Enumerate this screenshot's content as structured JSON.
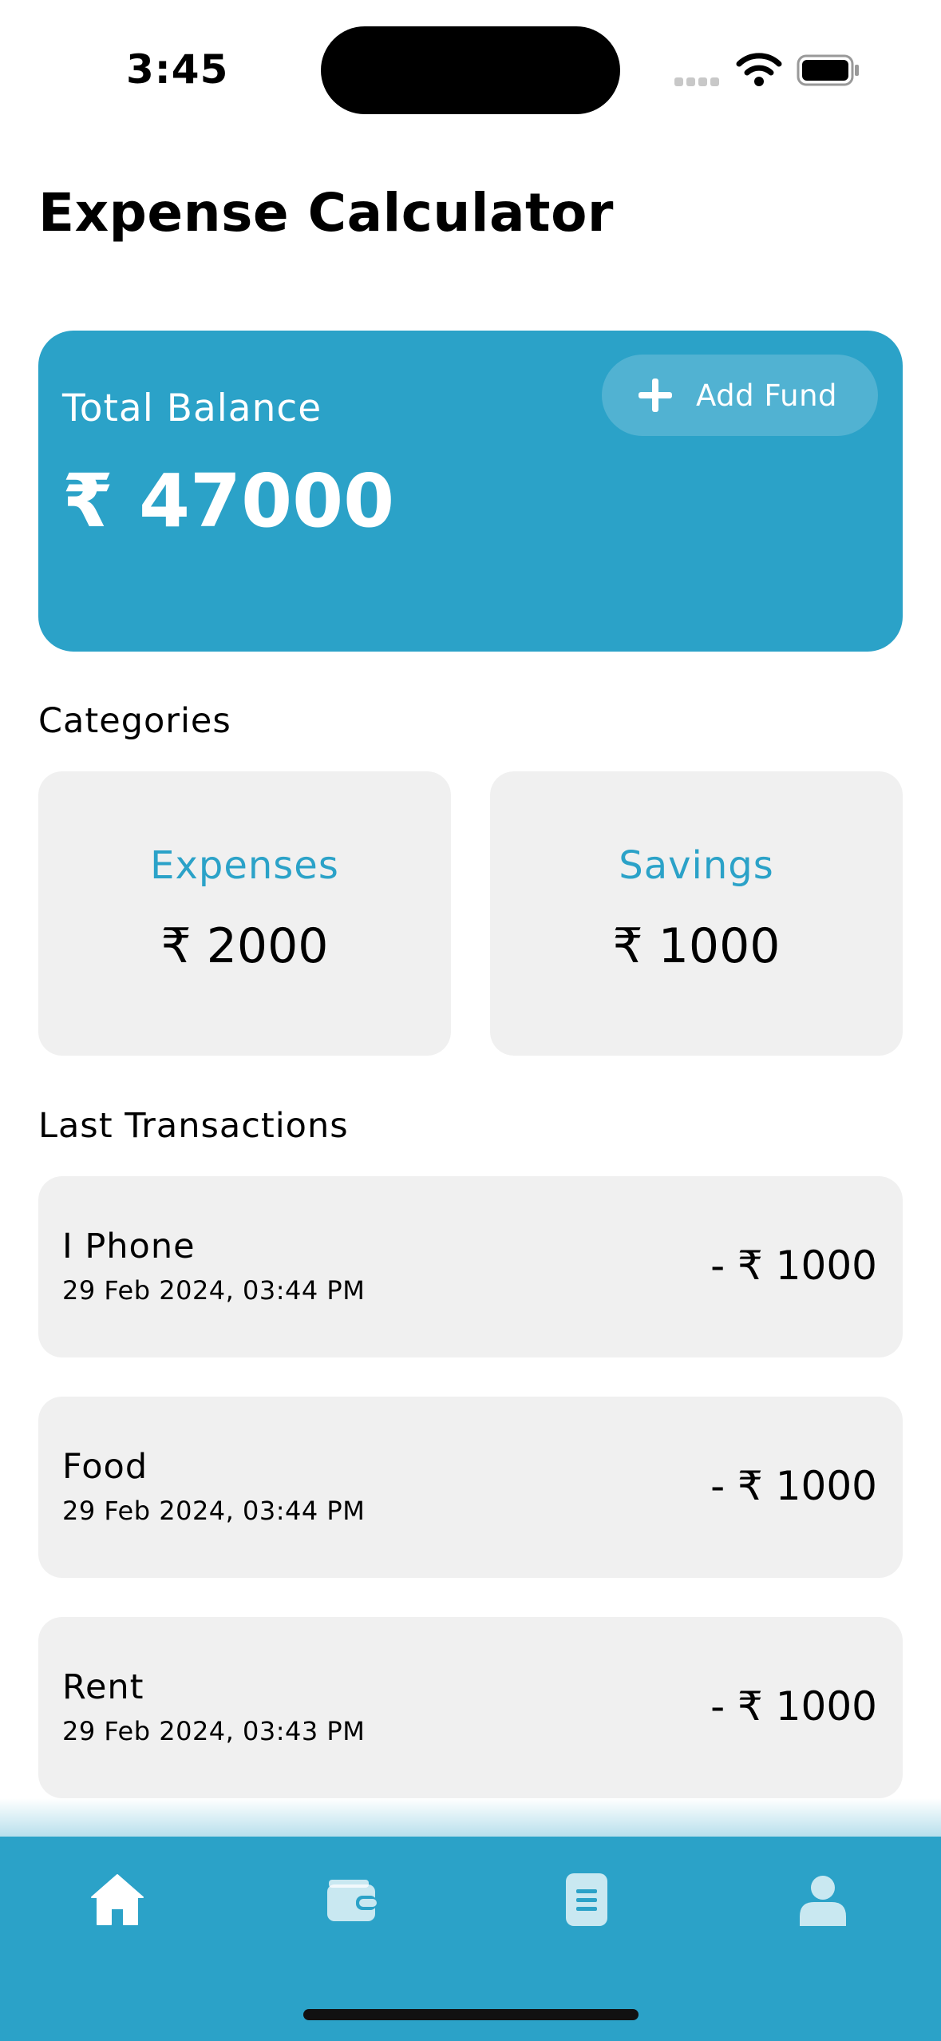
{
  "status_bar": {
    "time": "3:45"
  },
  "header": {
    "title": "Expense Calculator"
  },
  "balance": {
    "label": "Total Balance",
    "amount": "₹ 47000",
    "add_fund_label": "Add Fund"
  },
  "categories": {
    "title": "Categories",
    "items": [
      {
        "name": "Expenses",
        "amount": "₹ 2000"
      },
      {
        "name": "Savings",
        "amount": "₹ 1000"
      }
    ]
  },
  "transactions": {
    "title": "Last Transactions",
    "items": [
      {
        "name": "I Phone",
        "date": "29 Feb 2024, 03:44 PM",
        "amount": "- ₹ 1000"
      },
      {
        "name": "Food",
        "date": "29 Feb 2024, 03:44 PM",
        "amount": "- ₹ 1000"
      },
      {
        "name": "Rent",
        "date": "29 Feb 2024, 03:43 PM",
        "amount": "- ₹ 1000"
      }
    ]
  },
  "nav": {
    "icons": [
      "home-icon",
      "wallet-icon",
      "document-icon",
      "profile-icon"
    ],
    "active": "home-icon"
  },
  "colors": {
    "accent": "#2ba2c8",
    "card": "#f0f0f0"
  }
}
